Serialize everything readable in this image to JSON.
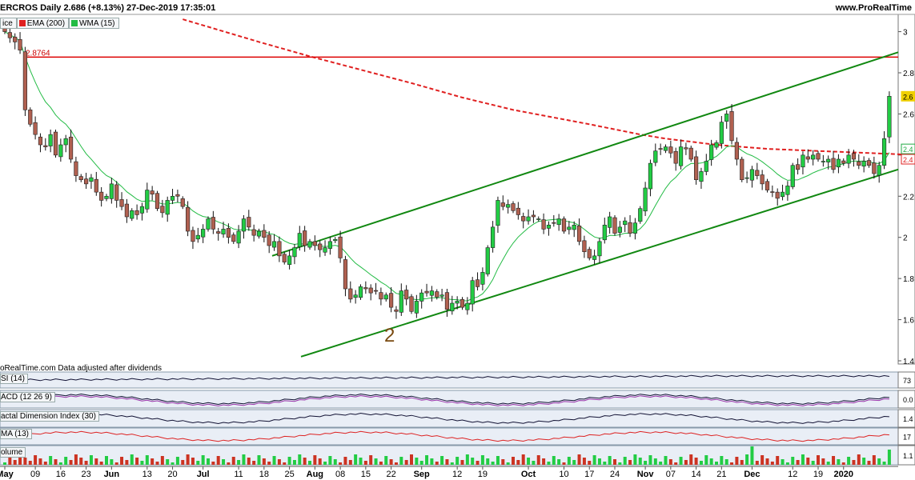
{
  "header": {
    "title": "ERCROS Daily 2.686 (+8.13%) 27-Dec-2019 17:35:01",
    "site": "www.ProRealTime"
  },
  "legend": [
    {
      "label": "ice",
      "color": ""
    },
    {
      "label": "EMA (200)",
      "color": "#e02020"
    },
    {
      "label": "WMA (15)",
      "color": "#22bb44"
    }
  ],
  "footnote": "oRealTime.com  Data adjusted after dividends",
  "panels": {
    "rsi": {
      "label": "SI (14)",
      "value": "73"
    },
    "macd": {
      "label": "ACD (12 26 9)",
      "value": "0.0"
    },
    "fdi": {
      "label": "actal Dimension Index (30)",
      "value": "1.4"
    },
    "ma": {
      "label": "MA (13)",
      "value": "17"
    },
    "volume": {
      "label": "olume",
      "value": "1.1"
    }
  },
  "chart_data": {
    "type": "candlestick",
    "ylim": [
      1.37,
      3.07
    ],
    "yticks": [
      1.4,
      1.6,
      1.8,
      2,
      2.2,
      2.4,
      2.6,
      2.8,
      3
    ],
    "ytick_labels": [
      "1.4",
      "1.6",
      "1.8",
      "2",
      "2.2",
      "2.4",
      "2.6",
      "2.8",
      "3"
    ],
    "xticks": [
      {
        "label": "May",
        "bold": true
      },
      {
        "label": "09"
      },
      {
        "label": "16"
      },
      {
        "label": "23"
      },
      {
        "label": "Jun",
        "bold": true
      },
      {
        "label": "13"
      },
      {
        "label": "20"
      },
      {
        "label": "Jul",
        "bold": true
      },
      {
        "label": "11"
      },
      {
        "label": "18"
      },
      {
        "label": "25"
      },
      {
        "label": "Aug",
        "bold": true
      },
      {
        "label": "08"
      },
      {
        "label": "15"
      },
      {
        "label": "22"
      },
      {
        "label": "Sep",
        "bold": true
      },
      {
        "label": "12"
      },
      {
        "label": "19"
      },
      {
        "label": "Oct",
        "bold": true
      },
      {
        "label": "10"
      },
      {
        "label": "17"
      },
      {
        "label": "24"
      },
      {
        "label": "Nov",
        "bold": true
      },
      {
        "label": "07"
      },
      {
        "label": "14"
      },
      {
        "label": "21"
      },
      {
        "label": "Dec",
        "bold": true
      },
      {
        "label": "12"
      },
      {
        "label": "19"
      },
      {
        "label": "2020",
        "bold": true
      }
    ],
    "xtick_index": [
      0,
      6,
      11,
      16,
      21,
      28,
      33,
      39,
      46,
      51,
      56,
      61,
      66,
      71,
      76,
      82,
      89,
      94,
      103,
      110,
      115,
      120,
      126,
      131,
      136,
      141,
      147,
      155,
      160,
      165
    ],
    "closes": [
      3.0,
      2.97,
      2.95,
      2.91,
      2.62,
      2.55,
      2.5,
      2.45,
      2.44,
      2.5,
      2.4,
      2.45,
      2.48,
      2.38,
      2.3,
      2.28,
      2.26,
      2.29,
      2.22,
      2.18,
      2.2,
      2.26,
      2.18,
      2.15,
      2.1,
      2.13,
      2.11,
      2.15,
      2.23,
      2.21,
      2.14,
      2.12,
      2.18,
      2.2,
      2.2,
      2.15,
      2.03,
      1.98,
      2.01,
      2.04,
      2.09,
      2.04,
      2.02,
      2.04,
      2.0,
      1.98,
      2.03,
      2.09,
      2.05,
      2.01,
      2.03,
      2.0,
      1.96,
      1.98,
      1.91,
      1.88,
      1.91,
      1.95,
      2.02,
      1.96,
      1.98,
      1.96,
      1.94,
      1.95,
      1.98,
      1.99,
      1.9,
      1.75,
      1.7,
      1.72,
      1.76,
      1.75,
      1.73,
      1.74,
      1.7,
      1.72,
      1.66,
      1.64,
      1.74,
      1.7,
      1.64,
      1.69,
      1.73,
      1.73,
      1.74,
      1.71,
      1.72,
      1.65,
      1.68,
      1.69,
      1.66,
      1.68,
      1.79,
      1.76,
      1.83,
      1.95,
      2.05,
      2.18,
      2.15,
      2.16,
      2.13,
      2.11,
      2.08,
      2.1,
      2.1,
      2.09,
      2.04,
      2.06,
      2.07,
      2.09,
      2.03,
      2.05,
      2.06,
      1.98,
      1.93,
      1.9,
      1.91,
      1.98,
      2.06,
      2.1,
      2.02,
      2.05,
      2.08,
      2.02,
      2.07,
      2.14,
      2.24,
      2.36,
      2.42,
      2.43,
      2.44,
      2.41,
      2.36,
      2.44,
      2.43,
      2.38,
      2.28,
      2.32,
      2.37,
      2.45,
      2.46,
      2.56,
      2.6,
      2.47,
      2.38,
      2.28,
      2.29,
      2.33,
      2.3,
      2.26,
      2.23,
      2.22,
      2.19,
      2.22,
      2.25,
      2.35,
      2.33,
      2.4,
      2.38,
      2.4,
      2.38,
      2.37,
      2.38,
      2.33,
      2.38,
      2.36,
      2.4,
      2.38,
      2.35,
      2.37,
      2.35,
      2.31,
      2.35,
      2.48,
      2.686
    ],
    "indicators": [
      "EMA (200)",
      "WMA (15)"
    ],
    "horizontal_line": {
      "value": 2.8764,
      "label": "2.8764"
    },
    "annotation": "2",
    "right_labels": [
      {
        "label": "2.6",
        "value": 2.686,
        "color": "#f0d000"
      },
      {
        "label": "2.4",
        "value": 2.43,
        "color": "#22aa44"
      },
      {
        "label": "2.4",
        "value": 2.38,
        "color": "#e02020"
      }
    ]
  }
}
